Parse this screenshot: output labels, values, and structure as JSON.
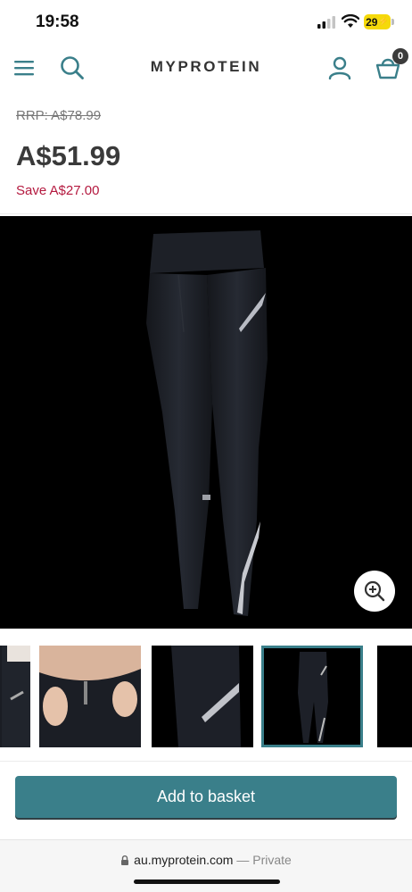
{
  "status_bar": {
    "time": "19:58",
    "battery": "29"
  },
  "header": {
    "logo": "MYPROTEIN",
    "basket_count": "0"
  },
  "pricing": {
    "rrp": "RRP: A$78.99",
    "price": "A$51.99",
    "save": "Save A$27.00"
  },
  "gallery": {
    "thumbnails": [
      {
        "id": "leggings-back"
      },
      {
        "id": "waistband-pocket"
      },
      {
        "id": "reflective-detail"
      },
      {
        "id": "full-leggings",
        "active": true
      },
      {
        "id": "partial"
      }
    ]
  },
  "actions": {
    "add_to_basket": "Add to basket"
  },
  "browser": {
    "url": "au.myprotein.com",
    "mode": "— Private"
  },
  "colors": {
    "accent": "#3a7f8a",
    "save_red": "#b4193f",
    "badge": "#3b3b3b",
    "battery": "#f5d90a"
  }
}
